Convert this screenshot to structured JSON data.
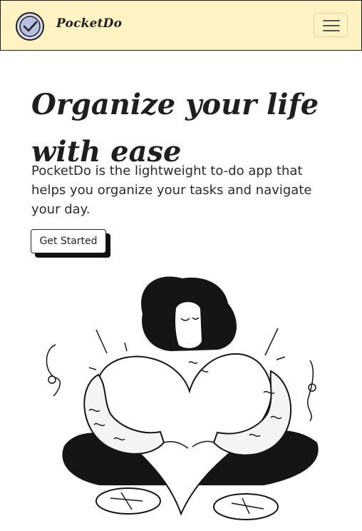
{
  "navbar": {
    "brand": "PocketDo",
    "logo_icon": "check-circle-icon",
    "menu_icon": "hamburger-menu-icon",
    "background": "#fff3c4"
  },
  "hero": {
    "title_line1": "Organize your life",
    "title_line2": "with ease",
    "description": "PocketDo is the lightweight to-do app that helps you organize your tasks and navigate your day.",
    "cta_label": "Get Started"
  },
  "illustration": {
    "subject": "person-hugging-heart-illustration"
  }
}
